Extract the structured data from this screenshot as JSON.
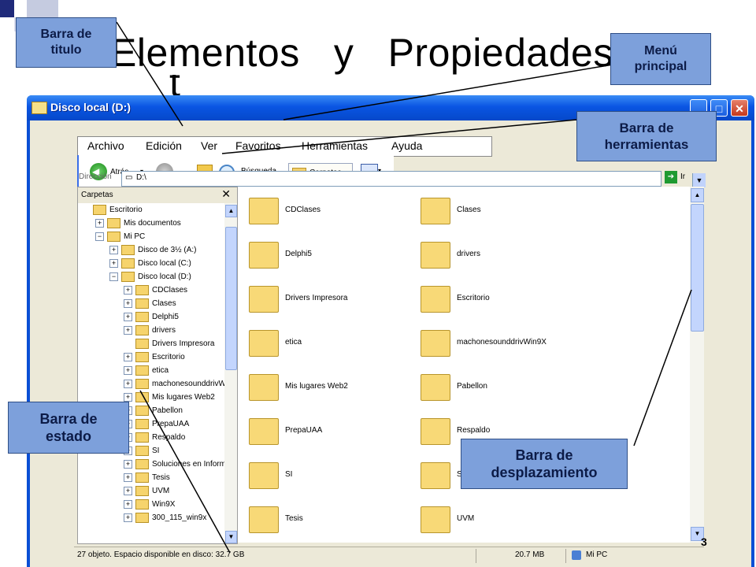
{
  "slide": {
    "title": "Elementos   y   Propiedades",
    "title_second_line": "t",
    "number": "3"
  },
  "window": {
    "title": "Disco local (D:)",
    "btn_minimize": "_",
    "btn_maximize": "□",
    "btn_close": "✕"
  },
  "menu": {
    "items": [
      "Archivo",
      "Edición",
      "Ver",
      "Favoritos",
      "Herramientas",
      "Ayuda"
    ]
  },
  "toolbar": {
    "back_label": "Atrás",
    "search_label": "Búsqueda",
    "folders_label": "Carpetas"
  },
  "address": {
    "label": "Dirección",
    "value": "D:\\",
    "go_label": "Ir"
  },
  "nav": {
    "header": "Carpetas",
    "close": "✕",
    "tree": [
      {
        "label": "Escritorio",
        "indent": 0,
        "expander": "",
        "icon": "desktop-icon"
      },
      {
        "label": "Mis documentos",
        "indent": 1,
        "expander": "+",
        "icon": "documents-icon"
      },
      {
        "label": "Mi PC",
        "indent": 1,
        "expander": "−",
        "icon": "computer-icon"
      },
      {
        "label": "Disco de 3½ (A:)",
        "indent": 2,
        "expander": "+",
        "icon": "floppy-icon"
      },
      {
        "label": "Disco local (C:)",
        "indent": 2,
        "expander": "+",
        "icon": "drive-icon"
      },
      {
        "label": "Disco local (D:)",
        "indent": 2,
        "expander": "−",
        "icon": "drive-icon"
      },
      {
        "label": "CDClases",
        "indent": 3,
        "expander": "+",
        "icon": "folder-icon"
      },
      {
        "label": "Clases",
        "indent": 3,
        "expander": "+",
        "icon": "folder-icon"
      },
      {
        "label": "Delphi5",
        "indent": 3,
        "expander": "+",
        "icon": "folder-icon"
      },
      {
        "label": "drivers",
        "indent": 3,
        "expander": "+",
        "icon": "folder-icon"
      },
      {
        "label": "Drivers Impresora",
        "indent": 3,
        "expander": "",
        "icon": "folder-icon"
      },
      {
        "label": "Escritorio",
        "indent": 3,
        "expander": "+",
        "icon": "folder-icon"
      },
      {
        "label": "etica",
        "indent": 3,
        "expander": "+",
        "icon": "folder-icon"
      },
      {
        "label": "machonesounddrivWi",
        "indent": 3,
        "expander": "+",
        "icon": "folder-icon"
      },
      {
        "label": "Mis lugares Web2",
        "indent": 3,
        "expander": "+",
        "icon": "folder-icon"
      },
      {
        "label": "Pabellon",
        "indent": 3,
        "expander": "+",
        "icon": "folder-icon"
      },
      {
        "label": "PrepaUAA",
        "indent": 3,
        "expander": "+",
        "icon": "folder-icon"
      },
      {
        "label": "Respaldo",
        "indent": 3,
        "expander": "+",
        "icon": "folder-icon"
      },
      {
        "label": "SI",
        "indent": 3,
        "expander": "+",
        "icon": "folder-icon"
      },
      {
        "label": "Soluciones en Informa",
        "indent": 3,
        "expander": "+",
        "icon": "folder-icon"
      },
      {
        "label": "Tesis",
        "indent": 3,
        "expander": "+",
        "icon": "folder-icon"
      },
      {
        "label": "UVM",
        "indent": 3,
        "expander": "+",
        "icon": "folder-icon"
      },
      {
        "label": "Win9X",
        "indent": 3,
        "expander": "+",
        "icon": "folder-icon"
      },
      {
        "label": "300_115_win9x",
        "indent": 3,
        "expander": "+",
        "icon": "folder-icon"
      }
    ]
  },
  "files": [
    "CDClases",
    "Clases",
    "Delphi5",
    "drivers",
    "Drivers Impresora",
    "Escritorio",
    "etica",
    "machonesounddrivWin9X",
    "Mis lugares Web2",
    "Pabellon",
    "PrepaUAA",
    "Respaldo",
    "SI",
    "S",
    "Tesis",
    "UVM"
  ],
  "status": {
    "objects": "27 objeto. Espacio disponible en disco: 32.7 GB",
    "size": "20.7 MB",
    "location": "Mi PC"
  },
  "callouts": {
    "titulo": "Barra de\ntitulo",
    "menu": "Menú\nprincipal",
    "herramientas": "Barra de\nherramientas",
    "estado": "Barra de\nestado",
    "desplazamiento": "Barra de\ndesplazamiento"
  },
  "colors": {
    "callout_fill": "#7da0db",
    "titlebar": "#0a55e3",
    "client": "#ece9d8"
  }
}
